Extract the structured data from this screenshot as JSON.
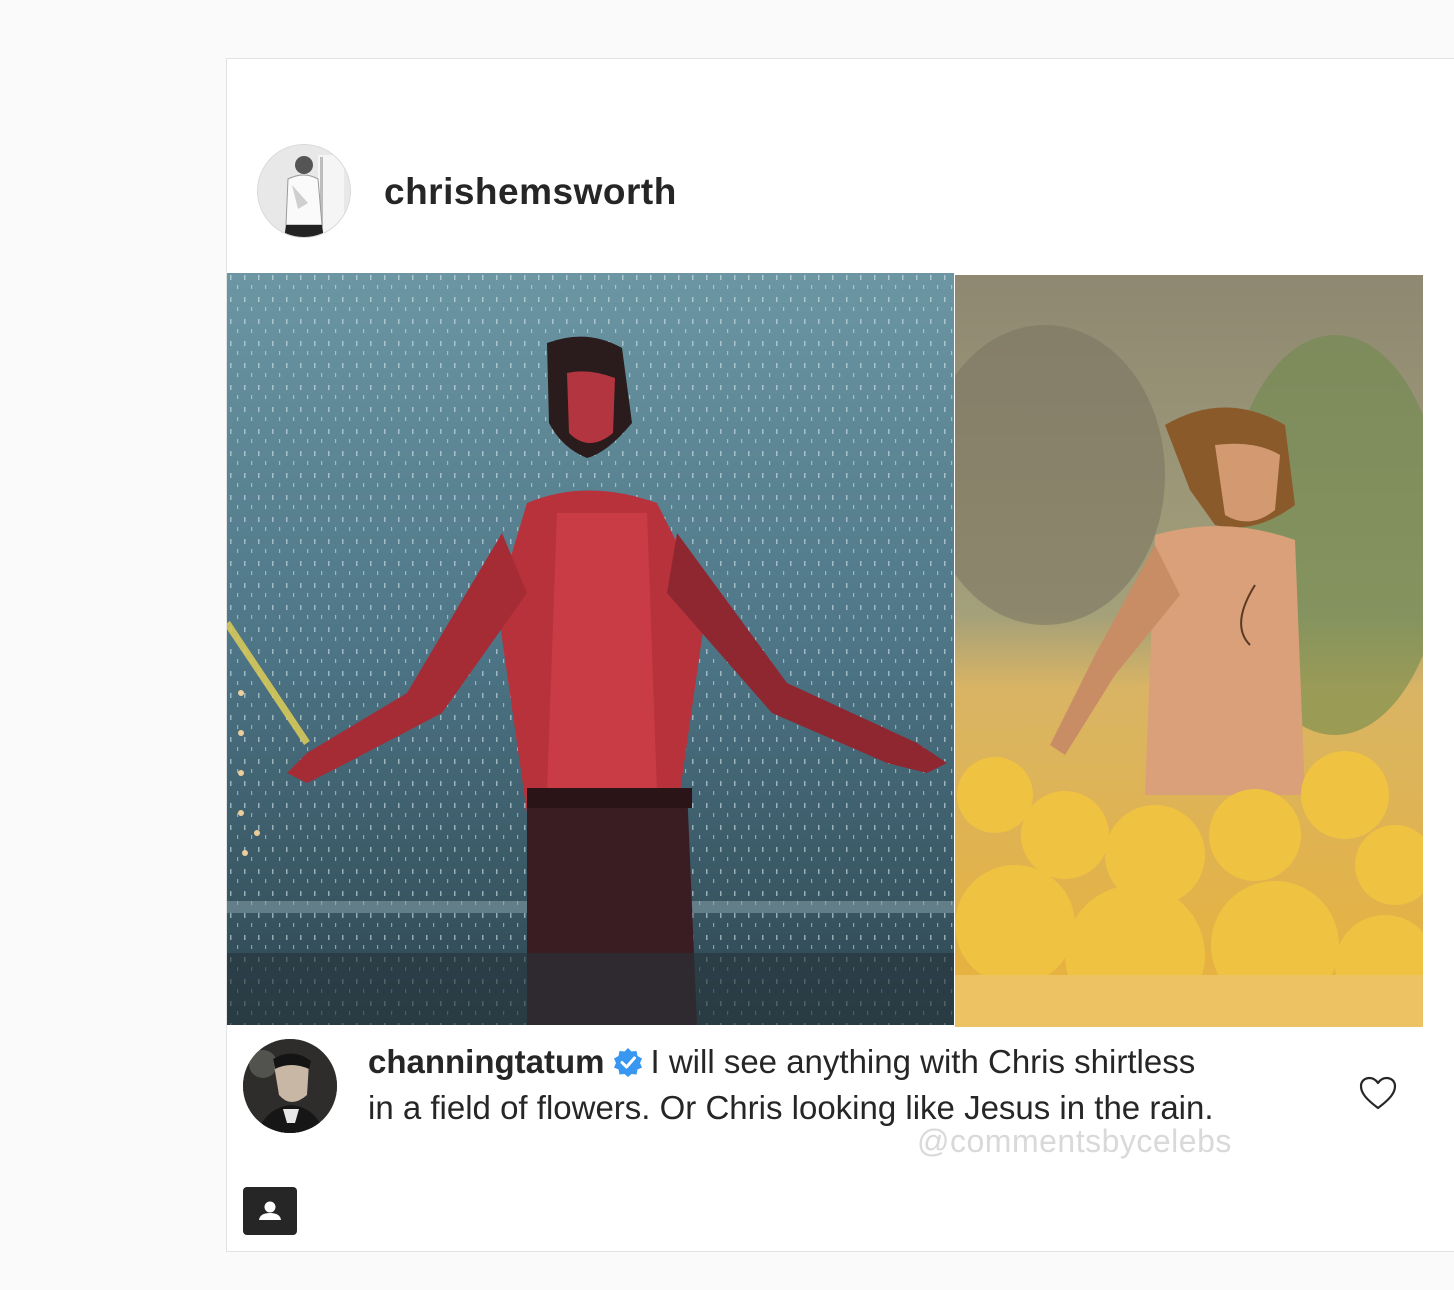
{
  "post": {
    "author_username": "chrishemsworth"
  },
  "comment": {
    "username": "channingtatum",
    "text": "I will see anything with Chris shirtless in a field of flowers.  Or Chris looking like Jesus in the rain.",
    "watermark": "@commentsbycelebs"
  },
  "colors": {
    "verified": "#3897f0",
    "text": "#262626",
    "watermark": "#d9d9d9"
  },
  "icons": {
    "verified": "verified-badge-icon",
    "like": "heart-outline-icon",
    "tag": "user-tag-icon"
  }
}
